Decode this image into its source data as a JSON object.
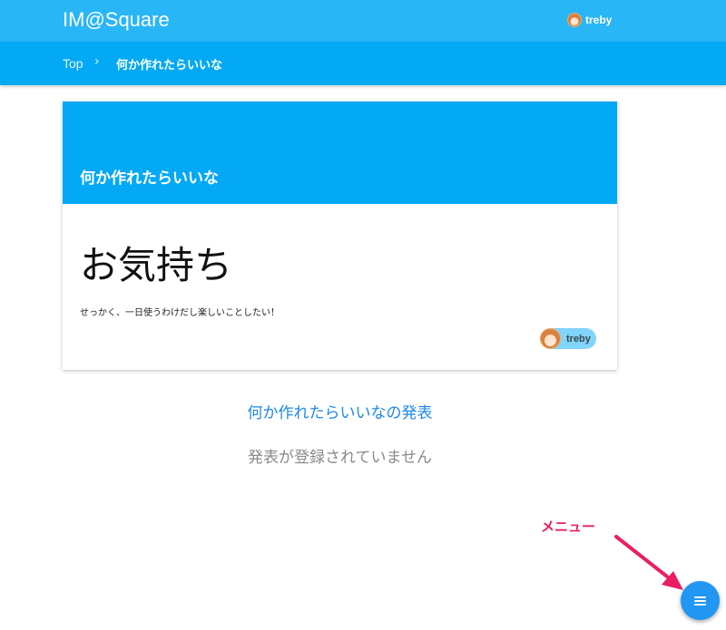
{
  "app": {
    "title": "IM@Square"
  },
  "user": {
    "name": "treby",
    "avatar": "user-avatar-icon"
  },
  "breadcrumb": {
    "items": [
      "Top",
      "何か作れたらいいな"
    ],
    "separator": "›"
  },
  "card": {
    "header_title": "何か作れたらいいな",
    "heading": "お気持ち",
    "body": "せっかく、一日使うわけだし楽しいことしたい！",
    "author": "treby"
  },
  "presentations": {
    "title": "何か作れたらいいなの発表",
    "empty_message": "発表が登録されていません"
  },
  "annotation": {
    "label": "メニュー"
  },
  "fab": {
    "icon": "menu-icon"
  },
  "colors": {
    "appbar": "#29b6f6",
    "breadcrumb_bar": "#03a9f4",
    "card_header": "#03a9f4",
    "author_chip": "#81d4fa",
    "link": "#1e88e5",
    "annotation": "#e91e63",
    "fab": "#2196f3"
  }
}
